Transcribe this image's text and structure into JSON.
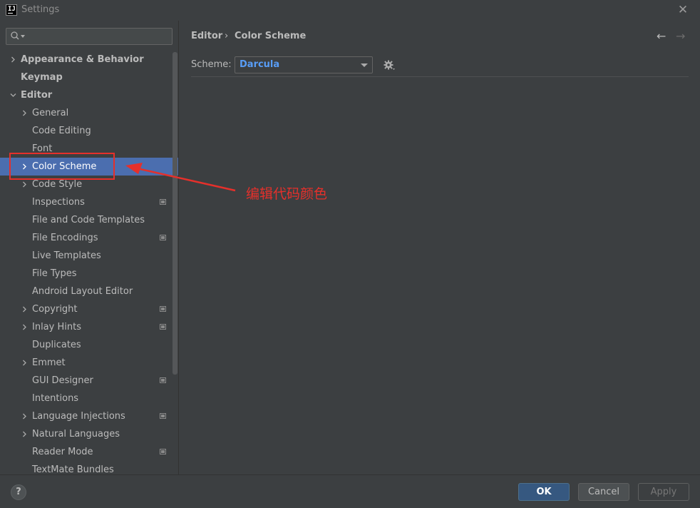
{
  "window": {
    "title": "Settings",
    "app_icon_text": "IJ"
  },
  "search": {
    "placeholder": ""
  },
  "tree": [
    {
      "label": "Appearance & Behavior",
      "chevron": "right",
      "bold": true,
      "indent": 0
    },
    {
      "label": "Keymap",
      "chevron": "none",
      "bold": true,
      "indent": 0
    },
    {
      "label": "Editor",
      "chevron": "down",
      "bold": true,
      "indent": 0
    },
    {
      "label": "General",
      "chevron": "right",
      "indent": 1
    },
    {
      "label": "Code Editing",
      "chevron": "none",
      "indent": 1
    },
    {
      "label": "Font",
      "chevron": "none",
      "indent": 1
    },
    {
      "label": "Color Scheme",
      "chevron": "right",
      "indent": 1,
      "selected": true
    },
    {
      "label": "Code Style",
      "chevron": "right",
      "indent": 1
    },
    {
      "label": "Inspections",
      "chevron": "none",
      "indent": 1,
      "project_icon": true
    },
    {
      "label": "File and Code Templates",
      "chevron": "none",
      "indent": 1
    },
    {
      "label": "File Encodings",
      "chevron": "none",
      "indent": 1,
      "project_icon": true
    },
    {
      "label": "Live Templates",
      "chevron": "none",
      "indent": 1
    },
    {
      "label": "File Types",
      "chevron": "none",
      "indent": 1
    },
    {
      "label": "Android Layout Editor",
      "chevron": "none",
      "indent": 1
    },
    {
      "label": "Copyright",
      "chevron": "right",
      "indent": 1,
      "project_icon": true
    },
    {
      "label": "Inlay Hints",
      "chevron": "right",
      "indent": 1,
      "project_icon": true
    },
    {
      "label": "Duplicates",
      "chevron": "none",
      "indent": 1
    },
    {
      "label": "Emmet",
      "chevron": "right",
      "indent": 1
    },
    {
      "label": "GUI Designer",
      "chevron": "none",
      "indent": 1,
      "project_icon": true
    },
    {
      "label": "Intentions",
      "chevron": "none",
      "indent": 1
    },
    {
      "label": "Language Injections",
      "chevron": "right",
      "indent": 1,
      "project_icon": true
    },
    {
      "label": "Natural Languages",
      "chevron": "right",
      "indent": 1
    },
    {
      "label": "Reader Mode",
      "chevron": "none",
      "indent": 1,
      "project_icon": true
    },
    {
      "label": "TextMate Bundles",
      "chevron": "none",
      "indent": 1
    }
  ],
  "annotation": {
    "text": "编辑代码颜色",
    "color": "#e5302b"
  },
  "main": {
    "breadcrumb": {
      "parent": "Editor",
      "separator": "›",
      "current": "Color Scheme"
    },
    "nav": {
      "back": "←",
      "forward": "→"
    },
    "scheme_label": "Scheme:",
    "scheme_value": "Darcula"
  },
  "footer": {
    "help": "?",
    "ok": "OK",
    "cancel": "Cancel",
    "apply": "Apply"
  },
  "colors": {
    "background": "#3c3f41",
    "selection": "#4b6eaf",
    "accent_link": "#589df6",
    "ok_button": "#365880"
  }
}
